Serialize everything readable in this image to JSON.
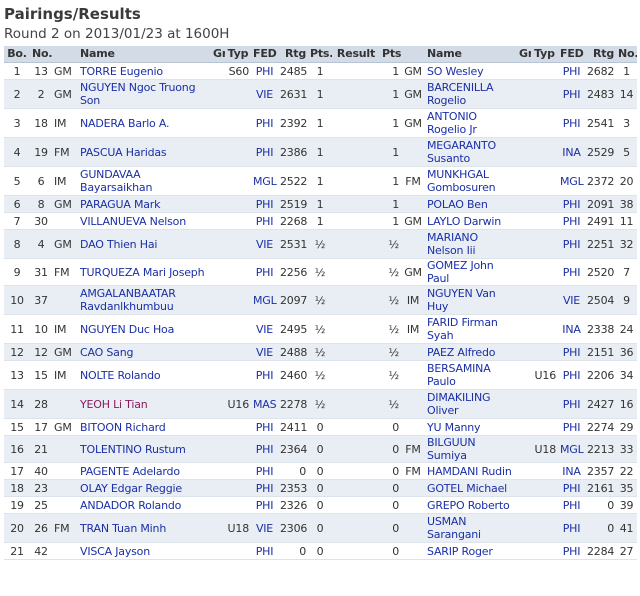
{
  "header": {
    "title": "Pairings/Results",
    "subtitle": "Round 2 on 2013/01/23 at 1600H"
  },
  "columns": [
    "Bo.",
    "No.",
    "",
    "Name",
    "Gr",
    "Typ",
    "FED",
    "Rtg",
    "Pts.",
    "Result",
    "Pts.",
    "",
    "Name",
    "Gr",
    "Typ",
    "FED",
    "Rtg",
    "No."
  ],
  "rows": [
    {
      "bo": "1",
      "no1": "13",
      "t1": "GM",
      "n1": "TORRE Eugenio",
      "gr1": "",
      "ty1": "S60",
      "f1": "PHI",
      "r1": "2485",
      "p1": "1",
      "res": "",
      "p2": "1",
      "t2": "GM",
      "n2": "SO Wesley",
      "gr2": "",
      "ty2": "",
      "f2": "PHI",
      "r2": "2682",
      "no2": "1"
    },
    {
      "bo": "2",
      "no1": "2",
      "t1": "GM",
      "n1": "NGUYEN Ngoc Truong Son",
      "gr1": "",
      "ty1": "",
      "f1": "VIE",
      "r1": "2631",
      "p1": "1",
      "res": "",
      "p2": "1",
      "t2": "GM",
      "n2": "BARCENILLA Rogelio",
      "gr2": "",
      "ty2": "",
      "f2": "PHI",
      "r2": "2483",
      "no2": "14"
    },
    {
      "bo": "3",
      "no1": "18",
      "t1": "IM",
      "n1": "NADERA Barlo A.",
      "gr1": "",
      "ty1": "",
      "f1": "PHI",
      "r1": "2392",
      "p1": "1",
      "res": "",
      "p2": "1",
      "t2": "GM",
      "n2": "ANTONIO Rogelio Jr",
      "gr2": "",
      "ty2": "",
      "f2": "PHI",
      "r2": "2541",
      "no2": "3"
    },
    {
      "bo": "4",
      "no1": "19",
      "t1": "FM",
      "n1": "PASCUA Haridas",
      "gr1": "",
      "ty1": "",
      "f1": "PHI",
      "r1": "2386",
      "p1": "1",
      "res": "",
      "p2": "1",
      "t2": "",
      "n2": "MEGARANTO Susanto",
      "gr2": "",
      "ty2": "",
      "f2": "INA",
      "r2": "2529",
      "no2": "5"
    },
    {
      "bo": "5",
      "no1": "6",
      "t1": "IM",
      "n1": "GUNDAVAA Bayarsaikhan",
      "gr1": "",
      "ty1": "",
      "f1": "MGL",
      "r1": "2522",
      "p1": "1",
      "res": "",
      "p2": "1",
      "t2": "FM",
      "n2": "MUNKHGAL Gombosuren",
      "gr2": "",
      "ty2": "",
      "f2": "MGL",
      "r2": "2372",
      "no2": "20"
    },
    {
      "bo": "6",
      "no1": "8",
      "t1": "GM",
      "n1": "PARAGUA Mark",
      "gr1": "",
      "ty1": "",
      "f1": "PHI",
      "r1": "2519",
      "p1": "1",
      "res": "",
      "p2": "1",
      "t2": "",
      "n2": "POLAO Ben",
      "gr2": "",
      "ty2": "",
      "f2": "PHI",
      "r2": "2091",
      "no2": "38"
    },
    {
      "bo": "7",
      "no1": "30",
      "t1": "",
      "n1": "VILLANUEVA Nelson",
      "gr1": "",
      "ty1": "",
      "f1": "PHI",
      "r1": "2268",
      "p1": "1",
      "res": "",
      "p2": "1",
      "t2": "GM",
      "n2": "LAYLO Darwin",
      "gr2": "",
      "ty2": "",
      "f2": "PHI",
      "r2": "2491",
      "no2": "11"
    },
    {
      "bo": "8",
      "no1": "4",
      "t1": "GM",
      "n1": "DAO Thien Hai",
      "gr1": "",
      "ty1": "",
      "f1": "VIE",
      "r1": "2531",
      "p1": "½",
      "res": "",
      "p2": "½",
      "t2": "",
      "n2": "MARIANO Nelson Iii",
      "gr2": "",
      "ty2": "",
      "f2": "PHI",
      "r2": "2251",
      "no2": "32"
    },
    {
      "bo": "9",
      "no1": "31",
      "t1": "FM",
      "n1": "TURQUEZA Mari Joseph",
      "gr1": "",
      "ty1": "",
      "f1": "PHI",
      "r1": "2256",
      "p1": "½",
      "res": "",
      "p2": "½",
      "t2": "GM",
      "n2": "GOMEZ John Paul",
      "gr2": "",
      "ty2": "",
      "f2": "PHI",
      "r2": "2520",
      "no2": "7"
    },
    {
      "bo": "10",
      "no1": "37",
      "t1": "",
      "n1": "AMGALANBAATAR Ravdanlkhumbuu",
      "gr1": "",
      "ty1": "",
      "f1": "MGL",
      "r1": "2097",
      "p1": "½",
      "res": "",
      "p2": "½",
      "t2": "IM",
      "n2": "NGUYEN Van Huy",
      "gr2": "",
      "ty2": "",
      "f2": "VIE",
      "r2": "2504",
      "no2": "9"
    },
    {
      "bo": "11",
      "no1": "10",
      "t1": "IM",
      "n1": "NGUYEN Duc Hoa",
      "gr1": "",
      "ty1": "",
      "f1": "VIE",
      "r1": "2495",
      "p1": "½",
      "res": "",
      "p2": "½",
      "t2": "IM",
      "n2": "FARID Firman Syah",
      "gr2": "",
      "ty2": "",
      "f2": "INA",
      "r2": "2338",
      "no2": "24"
    },
    {
      "bo": "12",
      "no1": "12",
      "t1": "GM",
      "n1": "CAO Sang",
      "gr1": "",
      "ty1": "",
      "f1": "VIE",
      "r1": "2488",
      "p1": "½",
      "res": "",
      "p2": "½",
      "t2": "",
      "n2": "PAEZ Alfredo",
      "gr2": "",
      "ty2": "",
      "f2": "PHI",
      "r2": "2151",
      "no2": "36"
    },
    {
      "bo": "13",
      "no1": "15",
      "t1": "IM",
      "n1": "NOLTE Rolando",
      "gr1": "",
      "ty1": "",
      "f1": "PHI",
      "r1": "2460",
      "p1": "½",
      "res": "",
      "p2": "½",
      "t2": "",
      "n2": "BERSAMINA Paulo",
      "gr2": "",
      "ty2": "U16",
      "f2": "PHI",
      "r2": "2206",
      "no2": "34"
    },
    {
      "bo": "14",
      "no1": "28",
      "t1": "",
      "n1": "YEOH Li Tian",
      "gr1": "",
      "ty1": "U16",
      "f1": "MAS",
      "r1": "2278",
      "p1": "½",
      "res": "",
      "p2": "½",
      "t2": "",
      "n2": "DIMAKILING Oliver",
      "gr2": "",
      "ty2": "",
      "f2": "PHI",
      "r2": "2427",
      "no2": "16"
    },
    {
      "bo": "15",
      "no1": "17",
      "t1": "GM",
      "n1": "BITOON Richard",
      "gr1": "",
      "ty1": "",
      "f1": "PHI",
      "r1": "2411",
      "p1": "0",
      "res": "",
      "p2": "0",
      "t2": "",
      "n2": "YU Manny",
      "gr2": "",
      "ty2": "",
      "f2": "PHI",
      "r2": "2274",
      "no2": "29"
    },
    {
      "bo": "16",
      "no1": "21",
      "t1": "",
      "n1": "TOLENTINO Rustum",
      "gr1": "",
      "ty1": "",
      "f1": "PHI",
      "r1": "2364",
      "p1": "0",
      "res": "",
      "p2": "0",
      "t2": "FM",
      "n2": "BILGUUN Sumiya",
      "gr2": "",
      "ty2": "U18",
      "f2": "MGL",
      "r2": "2213",
      "no2": "33"
    },
    {
      "bo": "17",
      "no1": "40",
      "t1": "",
      "n1": "PAGENTE Adelardo",
      "gr1": "",
      "ty1": "",
      "f1": "PHI",
      "r1": "0",
      "p1": "0",
      "res": "",
      "p2": "0",
      "t2": "FM",
      "n2": "HAMDANI Rudin",
      "gr2": "",
      "ty2": "",
      "f2": "INA",
      "r2": "2357",
      "no2": "22"
    },
    {
      "bo": "18",
      "no1": "23",
      "t1": "",
      "n1": "OLAY Edgar Reggie",
      "gr1": "",
      "ty1": "",
      "f1": "PHI",
      "r1": "2353",
      "p1": "0",
      "res": "",
      "p2": "0",
      "t2": "",
      "n2": "GOTEL Michael",
      "gr2": "",
      "ty2": "",
      "f2": "PHI",
      "r2": "2161",
      "no2": "35"
    },
    {
      "bo": "19",
      "no1": "25",
      "t1": "",
      "n1": "ANDADOR Rolando",
      "gr1": "",
      "ty1": "",
      "f1": "PHI",
      "r1": "2326",
      "p1": "0",
      "res": "",
      "p2": "0",
      "t2": "",
      "n2": "GREPO Roberto",
      "gr2": "",
      "ty2": "",
      "f2": "PHI",
      "r2": "0",
      "no2": "39"
    },
    {
      "bo": "20",
      "no1": "26",
      "t1": "FM",
      "n1": "TRAN Tuan Minh",
      "gr1": "",
      "ty1": "U18",
      "f1": "VIE",
      "r1": "2306",
      "p1": "0",
      "res": "",
      "p2": "0",
      "t2": "",
      "n2": "USMAN Sarangani",
      "gr2": "",
      "ty2": "",
      "f2": "PHI",
      "r2": "0",
      "no2": "41"
    },
    {
      "bo": "21",
      "no1": "42",
      "t1": "",
      "n1": "VISCA Jayson",
      "gr1": "",
      "ty1": "",
      "f1": "PHI",
      "r1": "0",
      "p1": "0",
      "res": "",
      "p2": "0",
      "t2": "",
      "n2": "SARIP Roger",
      "gr2": "",
      "ty2": "",
      "f2": "PHI",
      "r2": "2284",
      "no2": "27"
    }
  ],
  "colors": {
    "header_bg": "#d2dbe6",
    "stripe_bg": "#e9eef4",
    "name_link": "#1a2fa6",
    "name_youth": "#8b1a5c"
  }
}
